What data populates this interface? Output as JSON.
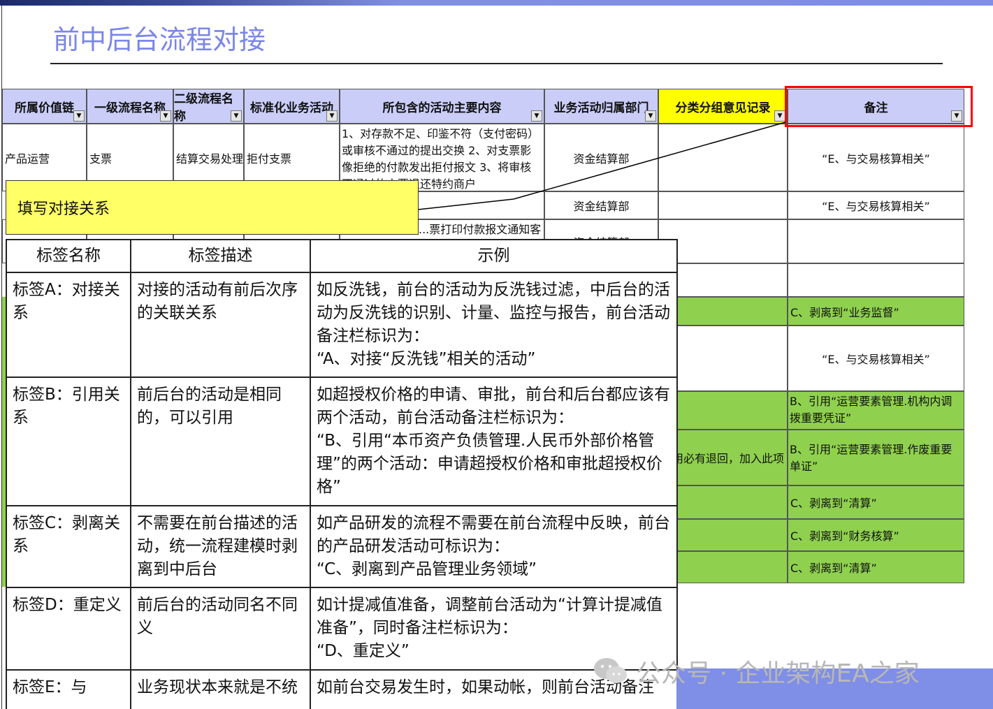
{
  "title": "前中后台流程对接",
  "sheet": {
    "headers": [
      "所属价值链",
      "一级流程名称",
      "二级流程名称",
      "标准化业务活动",
      "所包含的活动主要内容",
      "业务活动归属部门",
      "分类分组意见记录",
      "备注"
    ],
    "rows": [
      {
        "c1": "产品运营",
        "c2": "支票",
        "c3": "结算交易处理",
        "c4": "拒付支票",
        "c5": "1、对存款不足、印鉴不符（支付密码）或审核不通过的提出交换 2、对支票影像拒绝的付款发出拒付报文 3、将审核不通过的支票退还特约商户",
        "c6": "资金结算部",
        "c7": "",
        "c8": "“E、与交易核算相关”"
      },
      {
        "c1": "",
        "c2": "",
        "c3": "",
        "c4": "",
        "c5": "...",
        "c6": "资金结算部",
        "c7": "",
        "c8": "“E、与交易核算相关”"
      },
      {
        "c1": "...",
        "c2": "...",
        "c3": "...",
        "c4": "...",
        "c5": "...票打印付款报文通知客户",
        "c6": "资金结算部",
        "c7": "",
        "c8": ""
      },
      {
        "c8": ""
      },
      {
        "c8": "C、剥离到“业务监督”"
      },
      {
        "c8": "“E、与交易核算相关”"
      },
      {
        "c8": "B、引用“运营要素管理.机构内调拨重要凭证”"
      },
      {
        "c7": "...用必有退回，加入此项",
        "c8": "B、引用“运营要素管理.作废重要单证”"
      },
      {
        "c8": "C、剥离到“清算”"
      },
      {
        "c8": "C、剥离到“财务核算”"
      },
      {
        "c8": "C、剥离到“清算”"
      }
    ]
  },
  "callout": "填写对接关系",
  "label_table": {
    "headers": [
      "标签名称",
      "标签描述",
      "示例"
    ],
    "rows": [
      {
        "name": "标签A：对接关系",
        "desc": "对接的活动有前后次序的关联关系",
        "example": "如反洗钱，前台的活动为反洗钱过滤，中后台的活动为反洗钱的识别、计量、监控与报告，前台活动备注栏标识为：",
        "quote": "“A、对接“反洗钱”相关的活动”"
      },
      {
        "name": "标签B：引用关系",
        "desc": "前后台的活动是相同的，可以引用",
        "example": "如超授权价格的申请、审批，前台和后台都应该有两个活动，前台活动备注栏标识为：",
        "quote": "“B、引用“本币资产负债管理.人民币外部价格管理”的两个活动：申请超授权价格和审批超授权价格”"
      },
      {
        "name": "标签C：剥离关系",
        "desc": "不需要在前台描述的活动，统一流程建模时剥离到中后台",
        "example": "如产品研发的流程不需要在前台流程中反映，前台的产品研发活动可标识为：",
        "quote": "“C、剥离到产品管理业务领域”"
      },
      {
        "name": "标签D：重定义",
        "desc": "前后台的活动同名不同义",
        "example": "如计提减值准备，调整前台活动为“计算计提减值准备”，同时备注栏标识为：",
        "quote": "“D、重定义”"
      },
      {
        "name": "标签E：与",
        "desc": "业务现状本来就是不统",
        "example": "如前台交易发生时，如果动帐，则前台活动备注",
        "quote": ""
      }
    ]
  },
  "watermark": "公众号 · 企业架构EA之家",
  "colors": {
    "accent": "#7a86e8",
    "header": "#c9cdf7",
    "yellow": "#ffff00",
    "green": "#8fd14f",
    "red": "#ff0000"
  }
}
